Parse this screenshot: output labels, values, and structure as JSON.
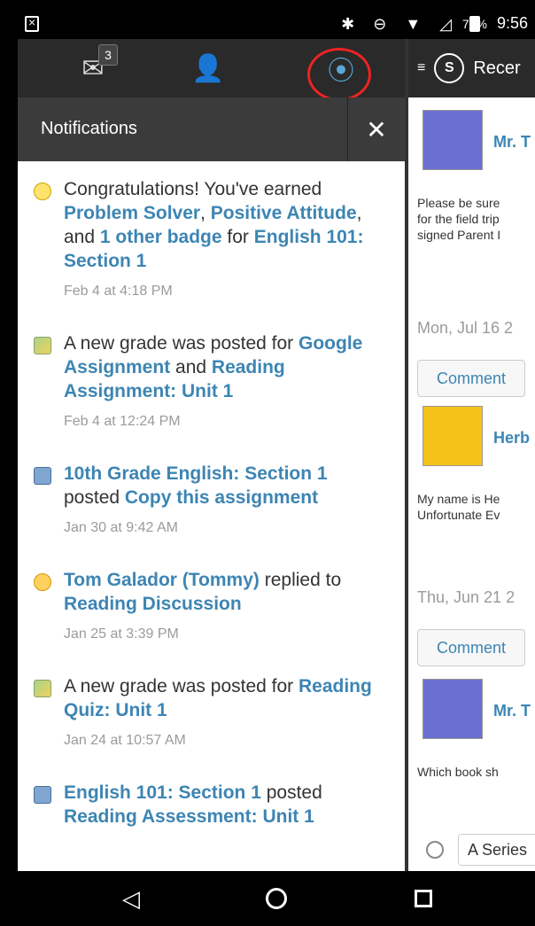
{
  "status": {
    "battery": "78%",
    "time": "9:56"
  },
  "toolbar": {
    "mail_badge": "3"
  },
  "notifications_header": {
    "title": "Notifications",
    "close_symbol": "✕"
  },
  "notifications": [
    {
      "type": "badge",
      "text_parts": [
        "Congratulations! You've earned ",
        "Problem Solver",
        ", ",
        "Positive Attitude",
        ", and ",
        "1 other badge",
        " for ",
        "English 101: Section 1"
      ],
      "time": "Feb 4 at 4:18 PM"
    },
    {
      "type": "grade",
      "text_parts": [
        "A new grade was posted for ",
        "Google Assignment",
        " and ",
        "Reading Assignment: Unit 1"
      ],
      "time": "Feb 4 at 12:24 PM"
    },
    {
      "type": "assignment",
      "text_parts": [
        "10th Grade English: Section 1",
        " posted ",
        "Copy this assignment"
      ],
      "time": "Jan 30 at 9:42 AM"
    },
    {
      "type": "discussion",
      "text_parts": [
        "Tom Galador (Tommy)",
        " replied to ",
        "Reading Discussion"
      ],
      "time": "Jan 25 at 3:39 PM"
    },
    {
      "type": "grade",
      "text_parts": [
        "A new grade was posted for ",
        "Reading Quiz: Unit 1"
      ],
      "time": "Jan 24 at 10:57 AM"
    },
    {
      "type": "assignment",
      "text_parts": [
        "English 101: Section 1",
        " posted ",
        "Reading Assessment: Unit 1"
      ],
      "time": ""
    }
  ],
  "right_panel": {
    "header_title": "Recer",
    "posts": [
      {
        "author": "Mr. T",
        "body_lines": [
          "Please be sure",
          "for the field trip",
          "signed Parent I"
        ],
        "date": "Mon, Jul 16 2",
        "comment": "Comment"
      },
      {
        "author": "Herb",
        "body_lines": [
          "My name is He",
          "Unfortunate Ev"
        ],
        "date": "Thu, Jun 21 2",
        "comment": "Comment"
      },
      {
        "author": "Mr. T",
        "body_lines": [
          "Which book sh"
        ],
        "date": "",
        "comment": ""
      }
    ],
    "poll_option": "A Series"
  }
}
